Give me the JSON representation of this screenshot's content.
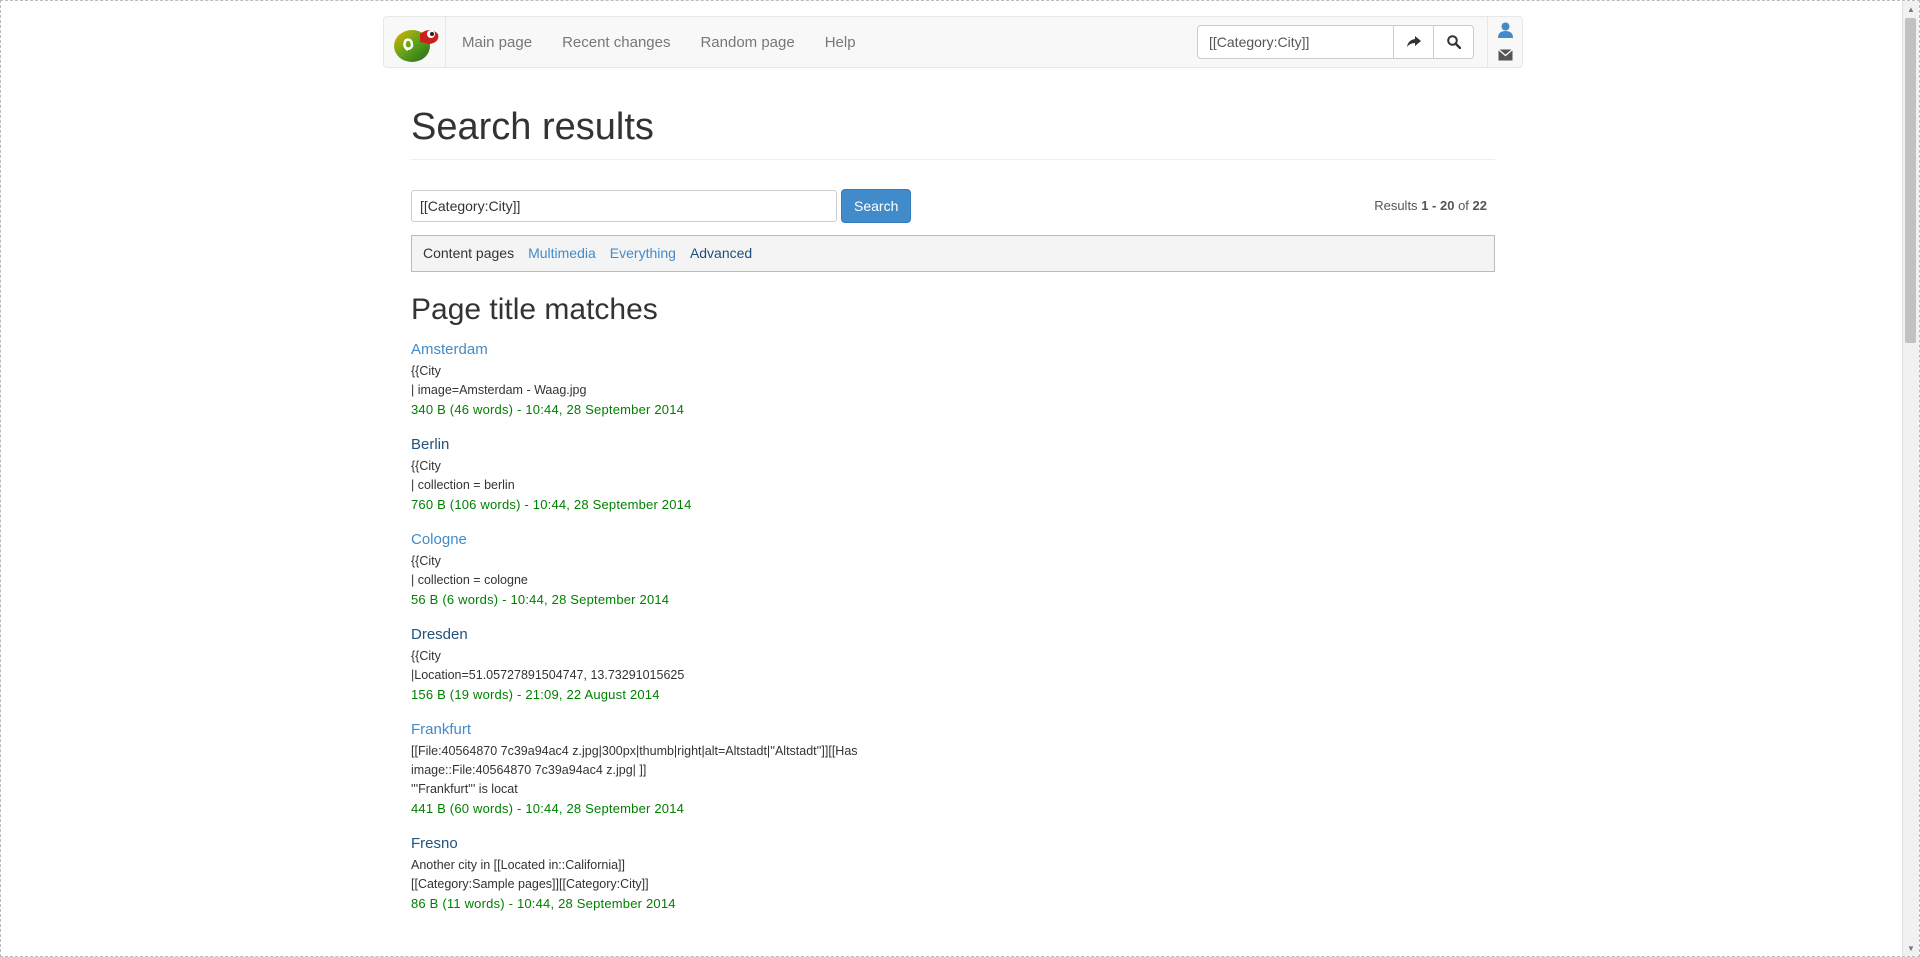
{
  "navbar": {
    "logo_icon": "chameleon-logo-icon",
    "links": [
      "Main page",
      "Recent changes",
      "Random page",
      "Help"
    ],
    "search_value": "[[Category:City]]",
    "go_icon": "share-arrow-icon",
    "search_icon": "search-icon",
    "user_icon": "user-icon",
    "mail_icon": "envelope-icon"
  },
  "page": {
    "title": "Search results",
    "search_value": "[[Category:City]]",
    "search_button": "Search",
    "results_prefix": "Results",
    "results_range": "1 - 20",
    "results_of": "of",
    "results_total": "22",
    "profiles": [
      "Content pages",
      "Multimedia",
      "Everything",
      "Advanced"
    ],
    "section_title": "Page title matches"
  },
  "results": [
    {
      "title": "Amsterdam",
      "lines": [
        "{{City",
        "| image=Amsterdam - Waag.jpg"
      ],
      "meta": "340 B (46 words) - 10:44, 28 September 2014"
    },
    {
      "title": "Berlin",
      "lines": [
        "{{City",
        "| collection = berlin"
      ],
      "meta": "760 B (106 words) - 10:44, 28 September 2014"
    },
    {
      "title": "Cologne",
      "lines": [
        "{{City",
        "| collection = cologne"
      ],
      "meta": "56 B (6 words) - 10:44, 28 September 2014"
    },
    {
      "title": "Dresden",
      "lines": [
        "{{City",
        "|Location=51.05727891504747, 13.73291015625"
      ],
      "meta": "156 B (19 words) - 21:09, 22 August 2014"
    },
    {
      "title": "Frankfurt",
      "lines": [
        "[[File:40564870 7c39a94ac4 z.jpg|300px|thumb|right|alt=Altstadt|''Altstadt'']][[Has",
        "image::File:40564870 7c39a94ac4 z.jpg| ]]",
        "'''Frankfurt''' is locat"
      ],
      "meta": "441 B (60 words) - 10:44, 28 September 2014"
    },
    {
      "title": "Fresno",
      "lines": [
        "Another city in [[Located in::California]]",
        "[[Category:Sample pages]][[Category:City]]"
      ],
      "meta": "86 B (11 words) - 10:44, 28 September 2014"
    }
  ],
  "colors": {
    "link": "#428bca",
    "visited_link": "#23527c",
    "meta_green": "#008000",
    "button_blue": "#428bca"
  }
}
